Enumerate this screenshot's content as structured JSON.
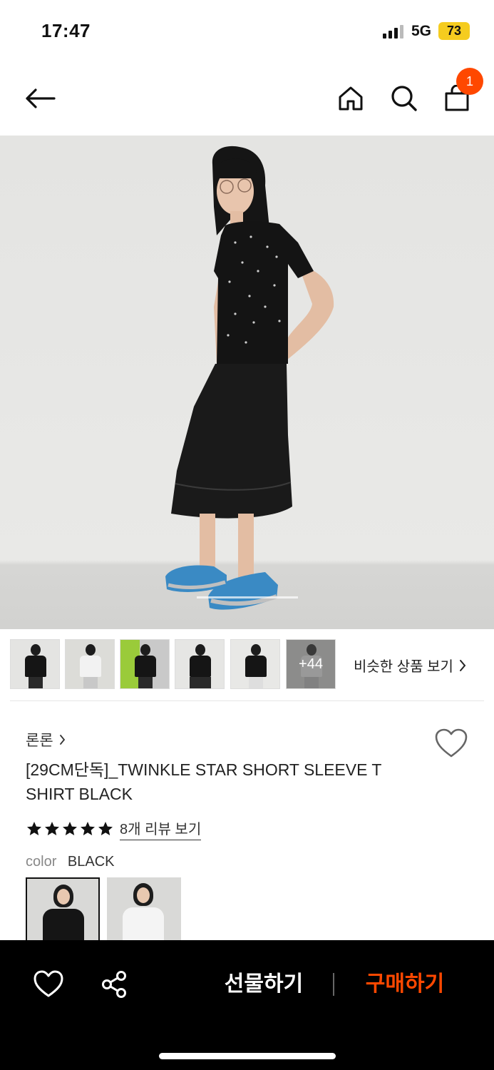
{
  "status_bar": {
    "time": "17:47",
    "network": "5G",
    "battery": "73"
  },
  "nav": {
    "back_icon": "arrow-left-icon",
    "home_icon": "home-icon",
    "search_icon": "search-icon",
    "cart_icon": "shopping-bag-icon",
    "cart_count": "1"
  },
  "gallery": {
    "thumbnails": [
      {
        "alt": "black tee front"
      },
      {
        "alt": "white tee"
      },
      {
        "alt": "black tee with car"
      },
      {
        "alt": "black tee skirt"
      },
      {
        "alt": "black tee arms"
      },
      {
        "alt": "white tee more"
      }
    ],
    "more_count": "+44",
    "similar_label": "비슷한 상품 보기"
  },
  "product": {
    "brand": "론론",
    "title": "[29CM단독]_TWINKLE STAR SHORT SLEEVE T SHIRT BLACK",
    "rating_stars": 5,
    "review_link": "8개 리뷰 보기",
    "color_label": "color",
    "color_value": "BLACK",
    "color_options": [
      "BLACK",
      "WHITE"
    ]
  },
  "bottom_bar": {
    "gift_label": "선물하기",
    "buy_label": "구매하기"
  },
  "colors": {
    "accent": "#ff4800",
    "battery": "#f5cc1f",
    "bar_bg": "#000000"
  }
}
